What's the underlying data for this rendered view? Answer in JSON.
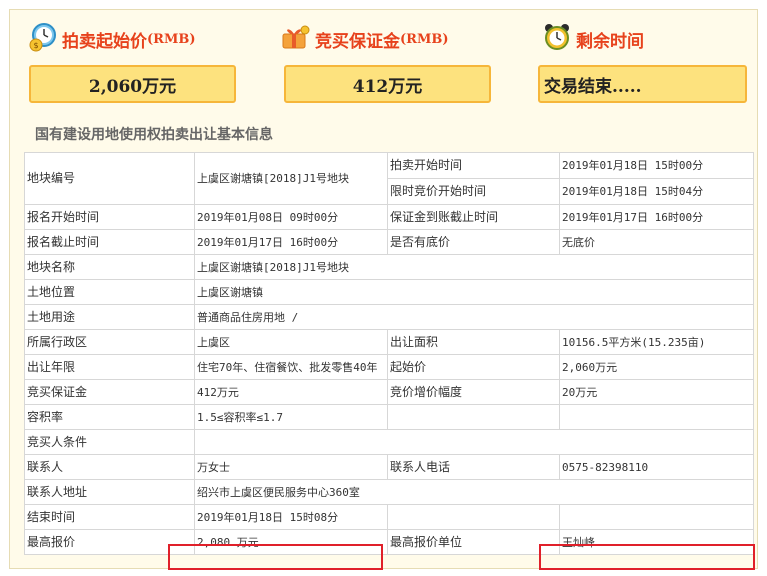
{
  "header": {
    "start_price": {
      "label": "拍卖起始价",
      "unit": "(RMB)",
      "value": "2,060万元"
    },
    "deposit": {
      "label": "竞买保证金",
      "unit": "(RMB)",
      "value": "412万元"
    },
    "remaining": {
      "label": "剩余时间",
      "value": "交易结束....."
    }
  },
  "section_title": "国有建设用地使用权拍卖出让基本信息",
  "rows": {
    "r1": {
      "k1": "地块编号",
      "v1": "上虞区谢塘镇[2018]J1号地块",
      "k2": "拍卖开始时间",
      "v2": "2019年01月18日 15时00分"
    },
    "r2": {
      "k2": "限时竞价开始时间",
      "v2": "2019年01月18日 15时04分"
    },
    "r3": {
      "k1": "报名开始时间",
      "v1": "2019年01月08日 09时00分",
      "k2": "保证金到账截止时间",
      "v2": "2019年01月17日 16时00分"
    },
    "r4": {
      "k1": "报名截止时间",
      "v1": "2019年01月17日 16时00分",
      "k2": "是否有底价",
      "v2": "无底价"
    },
    "r5": {
      "k1": "地块名称",
      "v1": "上虞区谢塘镇[2018]J1号地块"
    },
    "r6": {
      "k1": "土地位置",
      "v1": "上虞区谢塘镇"
    },
    "r7": {
      "k1": "土地用途",
      "v1": "普通商品住房用地 /"
    },
    "r8": {
      "k1": "所属行政区",
      "v1": "上虞区",
      "k2": "出让面积",
      "v2": "10156.5平方米(15.235亩)"
    },
    "r9": {
      "k1": "出让年限",
      "v1": "住宅70年、住宿餐饮、批发零售40年",
      "k2": "起始价",
      "v2": "2,060万元"
    },
    "r10": {
      "k1": "竞买保证金",
      "v1": "412万元",
      "k2": "竞价增价幅度",
      "v2": "20万元"
    },
    "r11": {
      "k1": "容积率",
      "v1": "1.5≤容积率≤1.7"
    },
    "r12": {
      "k1": "竞买人条件",
      "v1": ""
    },
    "r13": {
      "k1": "联系人",
      "v1": "万女士",
      "k2": "联系人电话",
      "v2": "0575-82398110"
    },
    "r14": {
      "k1": "联系人地址",
      "v1": "绍兴市上虞区便民服务中心360室"
    },
    "r15": {
      "k1": "结束时间",
      "v1": "2019年01月18日 15时08分"
    },
    "r16": {
      "k1": "最高报价",
      "v1": "2,080 万元",
      "k2": "最高报价单位",
      "v2": "王灿峰"
    }
  },
  "icons": {
    "price": "clock-money-icon",
    "deposit": "gift-money-icon",
    "time": "alarm-clock-icon"
  },
  "colors": {
    "accent": "#e7421c",
    "box_fill": "#fde27e",
    "box_border": "#f6b63a",
    "highlight": "#e0202a"
  }
}
